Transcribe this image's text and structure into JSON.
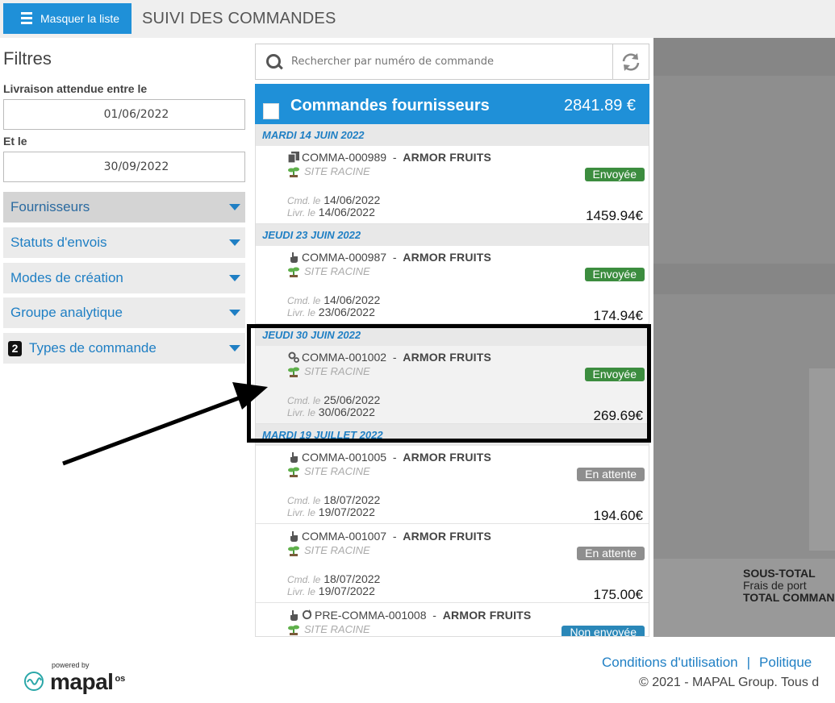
{
  "header": {
    "hide_list_label": "Masquer la liste",
    "page_title": "SUIVI DES COMMANDES"
  },
  "filters": {
    "title": "Filtres",
    "delivery_from_label": "Livraison attendue entre le",
    "delivery_from_value": "01/06/2022",
    "delivery_to_label": "Et le",
    "delivery_to_value": "30/09/2022",
    "sections": [
      {
        "label": "Fournisseurs"
      },
      {
        "label": "Statuts d'envois"
      },
      {
        "label": "Modes de création"
      },
      {
        "label": "Groupe analytique"
      },
      {
        "label": "Types de commande",
        "count": "2"
      }
    ]
  },
  "search": {
    "placeholder": "Rechercher par numéro de commande"
  },
  "orders": {
    "title": "Commandes fournisseurs",
    "total": "2841.89 €",
    "cmd_prefix": "Cmd. le",
    "livr_prefix": "Livr. le",
    "separator": "-",
    "groups": [
      {
        "date": "MARDI 14 JUIN 2022"
      },
      {
        "date": "JEUDI 23 JUIN 2022"
      },
      {
        "date": "JEUDI 30 JUIN 2022"
      },
      {
        "date": "MARDI 19 JUILLET 2022"
      }
    ],
    "items": [
      {
        "number": "COMMA-000989",
        "supplier": "ARMOR FRUITS",
        "site": "SITE RACINE",
        "status": "Envoyée",
        "cmd_date": "14/06/2022",
        "livr_date": "14/06/2022",
        "amount": "1459.94€",
        "type_icon": "copy-icon"
      },
      {
        "number": "COMMA-000987",
        "supplier": "ARMOR FRUITS",
        "site": "SITE RACINE",
        "status": "Envoyée",
        "cmd_date": "14/06/2022",
        "livr_date": "23/06/2022",
        "amount": "174.94€",
        "type_icon": "hand-icon"
      },
      {
        "number": "COMMA-001002",
        "supplier": "ARMOR FRUITS",
        "site": "SITE RACINE",
        "status": "Envoyée",
        "cmd_date": "25/06/2022",
        "livr_date": "30/06/2022",
        "amount": "269.69€",
        "type_icon": "gears-icon"
      },
      {
        "number": "COMMA-001005",
        "supplier": "ARMOR FRUITS",
        "site": "SITE RACINE",
        "status": "En attente",
        "cmd_date": "18/07/2022",
        "livr_date": "19/07/2022",
        "amount": "194.60€",
        "type_icon": "hand-icon"
      },
      {
        "number": "COMMA-001007",
        "supplier": "ARMOR FRUITS",
        "site": "SITE RACINE",
        "status": "En attente",
        "cmd_date": "18/07/2022",
        "livr_date": "19/07/2022",
        "amount": "175.00€",
        "type_icon": "hand-icon"
      },
      {
        "number": "PRE-COMMA-001008",
        "supplier": "ARMOR FRUITS",
        "site": "SITE RACINE",
        "status": "Non envoyée",
        "type_icon": "hand-icon"
      }
    ]
  },
  "detail_panel": {
    "subtotal_label": "SOUS-TOTAL",
    "shipping_label": "Frais de port",
    "total_label": "TOTAL COMMAN"
  },
  "footer": {
    "powered_by": "powered by",
    "logo_text": "mapal",
    "logo_suffix": "os",
    "terms_link": "Conditions d'utilisation",
    "separator": "|",
    "policy_link": "Politique",
    "copyright": "© 2021 - MAPAL Group. Tous d"
  },
  "colors": {
    "primary": "#1f90d8",
    "link": "#1f7fc4",
    "sent": "#3c8d3f",
    "waiting": "#8e8e8e",
    "not_sent": "#2a87b8"
  }
}
